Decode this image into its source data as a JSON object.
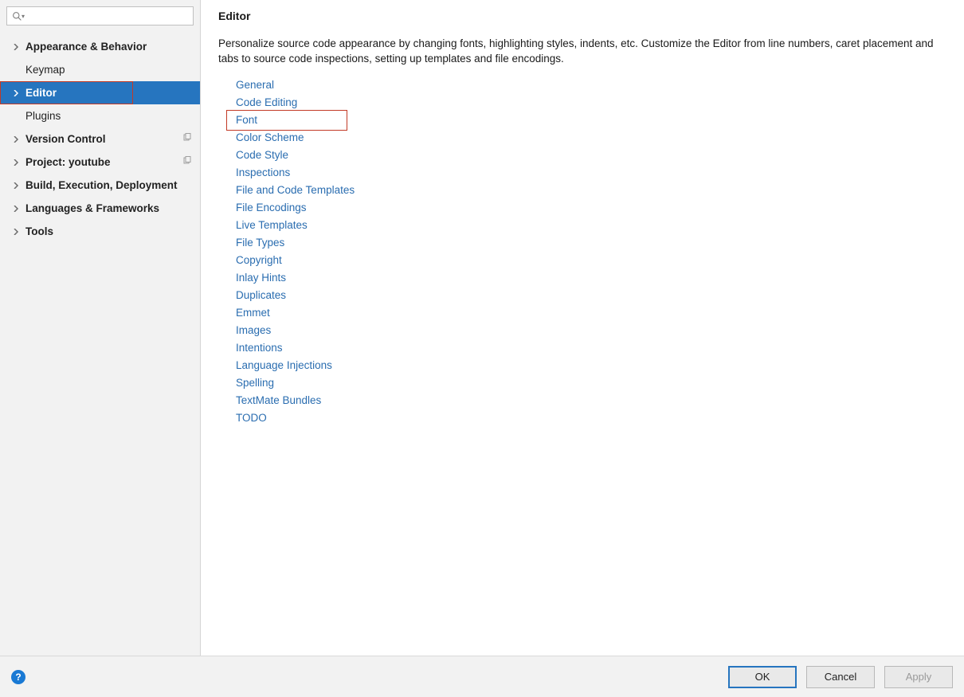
{
  "sidebar": {
    "search_placeholder": "",
    "items": [
      {
        "label": "Appearance & Behavior",
        "expandable": true,
        "selected": false
      },
      {
        "label": "Keymap",
        "expandable": false,
        "selected": false,
        "leaf": true
      },
      {
        "label": "Editor",
        "expandable": true,
        "selected": true,
        "highlight": true
      },
      {
        "label": "Plugins",
        "expandable": false,
        "selected": false,
        "leaf": true
      },
      {
        "label": "Version Control",
        "expandable": true,
        "selected": false,
        "trailing": "copy"
      },
      {
        "label": "Project: youtube",
        "expandable": true,
        "selected": false,
        "trailing": "copy"
      },
      {
        "label": "Build, Execution, Deployment",
        "expandable": true,
        "selected": false
      },
      {
        "label": "Languages & Frameworks",
        "expandable": true,
        "selected": false
      },
      {
        "label": "Tools",
        "expandable": true,
        "selected": false
      }
    ]
  },
  "content": {
    "title": "Editor",
    "description": "Personalize source code appearance by changing fonts, highlighting styles, indents, etc. Customize the Editor from line numbers, caret placement and tabs to source code inspections, setting up templates and file encodings.",
    "links": [
      {
        "label": "General"
      },
      {
        "label": "Code Editing"
      },
      {
        "label": "Font",
        "highlight": true
      },
      {
        "label": "Color Scheme"
      },
      {
        "label": "Code Style"
      },
      {
        "label": "Inspections"
      },
      {
        "label": "File and Code Templates"
      },
      {
        "label": "File Encodings"
      },
      {
        "label": "Live Templates"
      },
      {
        "label": "File Types"
      },
      {
        "label": "Copyright"
      },
      {
        "label": "Inlay Hints"
      },
      {
        "label": "Duplicates"
      },
      {
        "label": "Emmet"
      },
      {
        "label": "Images"
      },
      {
        "label": "Intentions"
      },
      {
        "label": "Language Injections"
      },
      {
        "label": "Spelling"
      },
      {
        "label": "TextMate Bundles"
      },
      {
        "label": "TODO"
      }
    ]
  },
  "buttons": {
    "help": "?",
    "ok": "OK",
    "cancel": "Cancel",
    "apply": "Apply"
  }
}
